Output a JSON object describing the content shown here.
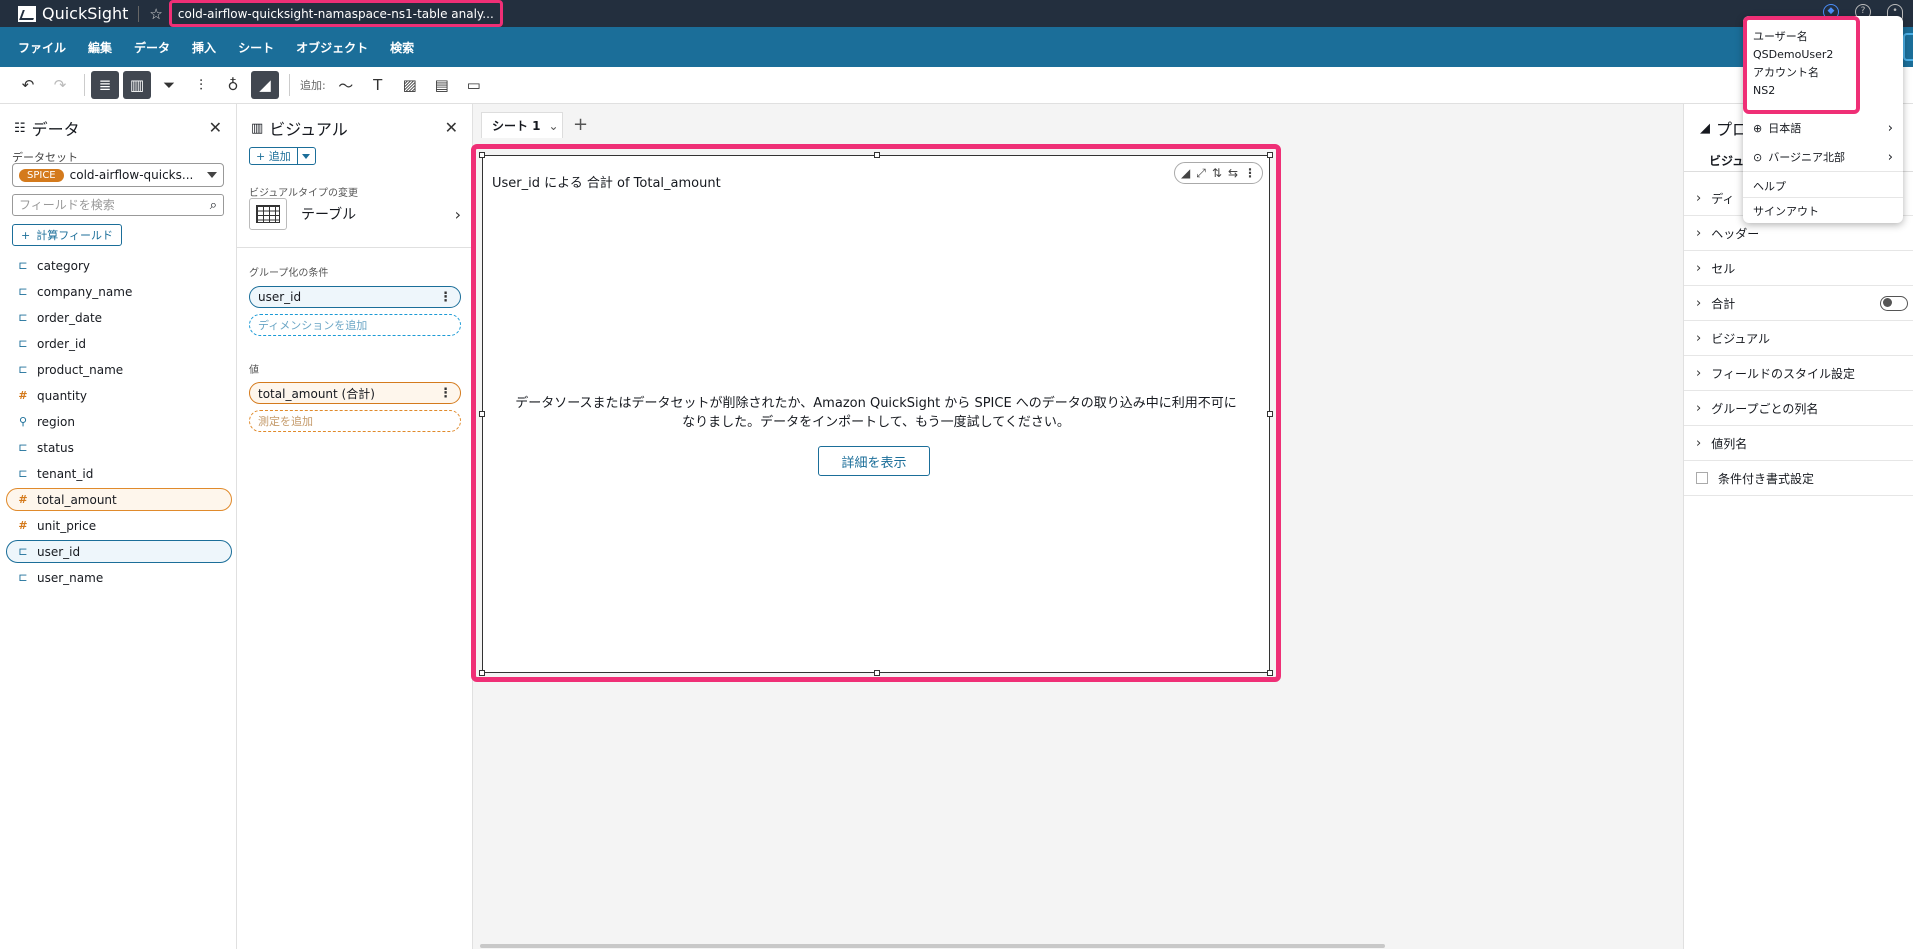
{
  "app": {
    "name": "QuickSight",
    "analysis_name": "cold-airflow-quicksight-namaspace-ns1-table analy..."
  },
  "menu": [
    "ファイル",
    "編集",
    "データ",
    "挿入",
    "シート",
    "オブジェクト",
    "検索"
  ],
  "toolbar": {
    "add_label": "追加:"
  },
  "data_panel": {
    "title": "データ",
    "dataset_label": "データセット",
    "spice_badge": "SPICE",
    "dataset_name": "cold-airflow-quicks...",
    "search_placeholder": "フィールドを検索",
    "calc_field_label": "計算フィールド",
    "fields": [
      {
        "name": "category",
        "kind": "dim",
        "sel": ""
      },
      {
        "name": "company_name",
        "kind": "dim",
        "sel": ""
      },
      {
        "name": "order_date",
        "kind": "dim",
        "sel": ""
      },
      {
        "name": "order_id",
        "kind": "dim",
        "sel": ""
      },
      {
        "name": "product_name",
        "kind": "dim",
        "sel": ""
      },
      {
        "name": "quantity",
        "kind": "meas",
        "sel": ""
      },
      {
        "name": "region",
        "kind": "geo",
        "sel": ""
      },
      {
        "name": "status",
        "kind": "dim",
        "sel": ""
      },
      {
        "name": "tenant_id",
        "kind": "dim",
        "sel": ""
      },
      {
        "name": "total_amount",
        "kind": "meas",
        "sel": "orange"
      },
      {
        "name": "unit_price",
        "kind": "meas",
        "sel": ""
      },
      {
        "name": "user_id",
        "kind": "dim",
        "sel": "blue"
      },
      {
        "name": "user_name",
        "kind": "dim",
        "sel": ""
      }
    ]
  },
  "visual_panel": {
    "title": "ビジュアル",
    "add_label": "追加",
    "change_type_label": "ビジュアルタイプの変更",
    "visual_type": "テーブル",
    "group_by_label": "グループ化の条件",
    "group_by_field": "user_id",
    "add_dimension": "ディメンションを追加",
    "values_label": "値",
    "value_field": "total_amount (合計)",
    "add_measure": "測定を追加"
  },
  "sheet": {
    "tab_label": "シート 1",
    "visual_title": "User_id による 合計 of Total_amount",
    "message_line1": "データソースまたはデータセットが削除されたか、Amazon QuickSight から SPICE へのデータの取り込み中に利用不可に",
    "message_line2": "なりました。データをインポートして、もう一度試してください。",
    "detail_button": "詳細を表示"
  },
  "properties": {
    "title": "プロ",
    "tab": "ビジュ",
    "rows": [
      {
        "label": "ディ",
        "type": "expand"
      },
      {
        "label": "ヘッダー",
        "type": "expand"
      },
      {
        "label": "セル",
        "type": "expand"
      },
      {
        "label": "合計",
        "type": "toggle"
      },
      {
        "label": "ビジュアル",
        "type": "expand"
      },
      {
        "label": "フィールドのスタイル設定",
        "type": "expand"
      },
      {
        "label": "グループごとの列名",
        "type": "expand"
      },
      {
        "label": "値列名",
        "type": "expand"
      },
      {
        "label": "条件付き書式設定",
        "type": "plain"
      }
    ]
  },
  "user_menu": {
    "username_label": "ユーザー名",
    "username": "QSDemoUser2",
    "account_label": "アカウント名",
    "account": "NS2",
    "language": "日本語",
    "region": "バージニア北部",
    "help": "ヘルプ",
    "signout": "サインアウト"
  },
  "colors": {
    "highlight": "#ef2f76",
    "menubar": "#1b6e99",
    "topbar": "#232f3e",
    "spice": "#d47a1c"
  }
}
